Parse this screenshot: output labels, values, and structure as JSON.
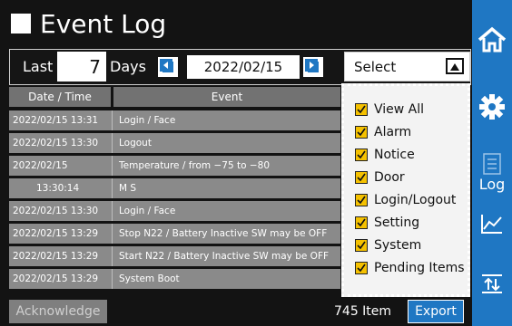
{
  "header": {
    "title": "Event Log"
  },
  "filter": {
    "last_label": "Last",
    "days_value": "7",
    "days_label": "Days",
    "date": "2022/02/15",
    "select_label": "Select"
  },
  "table": {
    "headers": {
      "datetime": "Date / Time",
      "event": "Event"
    },
    "rows": [
      {
        "datetime": "2022/02/15 13:31",
        "event": "Login / Face"
      },
      {
        "datetime": "2022/02/15 13:30",
        "event": "Logout"
      },
      {
        "datetime": "2022/02/15",
        "event": "Temperature / from −75 to −80"
      },
      {
        "datetime": "13:30:14",
        "event": "M S"
      },
      {
        "datetime": "2022/02/15 13:30",
        "event": "Login / Face"
      },
      {
        "datetime": "2022/02/15 13:29",
        "event": "Stop N22 / Battery Inactive SW may be OFF"
      },
      {
        "datetime": "2022/02/15 13:29",
        "event": "Start N22 / Battery Inactive SW may be OFF"
      },
      {
        "datetime": "2022/02/15 13:29",
        "event": "System Boot"
      }
    ]
  },
  "dropdown": {
    "options": [
      {
        "label": "View All",
        "checked": true
      },
      {
        "label": "Alarm",
        "checked": true
      },
      {
        "label": "Notice",
        "checked": true
      },
      {
        "label": "Door",
        "checked": true
      },
      {
        "label": "Login/Logout",
        "checked": true
      },
      {
        "label": "Setting",
        "checked": true
      },
      {
        "label": "System",
        "checked": true
      },
      {
        "label": "Pending Items",
        "checked": true
      }
    ]
  },
  "footer": {
    "acknowledge_label": "Acknowledge",
    "count_text": "745 Item",
    "export_label": "Export"
  },
  "nav": {
    "items": [
      {
        "icon": "home-icon"
      },
      {
        "icon": "gear-icon"
      },
      {
        "icon": "log-list-icon",
        "label": "Log"
      },
      {
        "icon": "chart-icon"
      },
      {
        "icon": "transfer-icon"
      }
    ]
  },
  "colors": {
    "accent": "#1f77c3",
    "checkbox": "#f5c100",
    "row_bg": "#8a8a8a",
    "header_bg": "#727272"
  }
}
